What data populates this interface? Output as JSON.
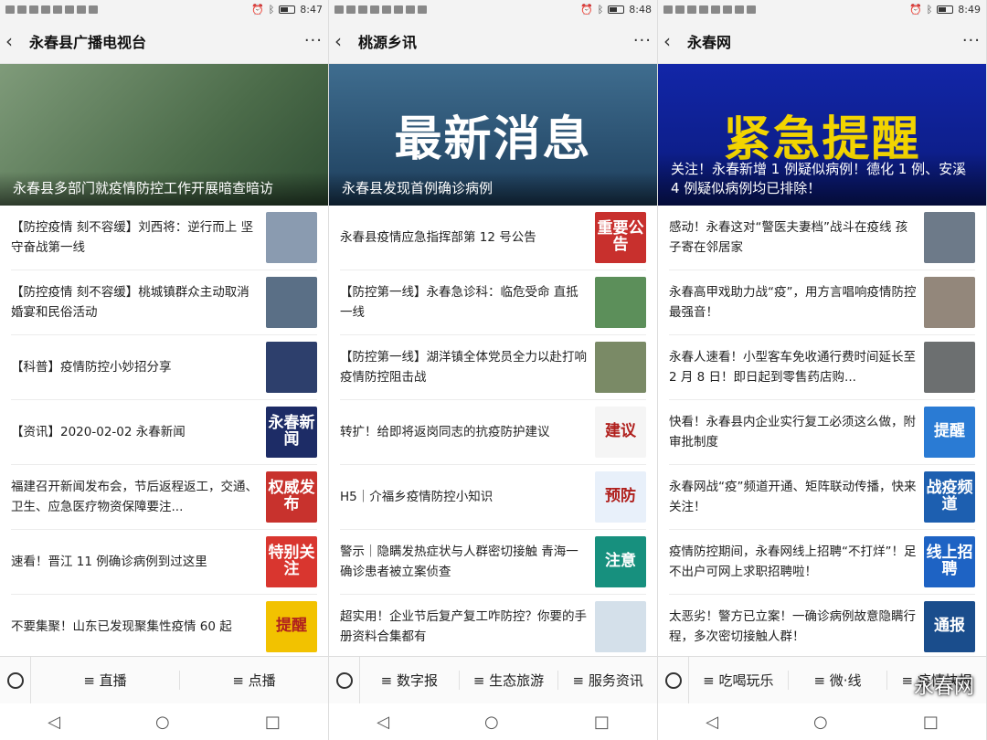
{
  "phones": [
    {
      "status": {
        "time": "8:47"
      },
      "title": "永春县广播电视台",
      "hero": {
        "caption": "永春县多部门就疫情防控工作开展暗查暗访",
        "bigtext": ""
      },
      "items": [
        {
          "text": "【防控疫情 刻不容缓】刘西将：逆行而上 坚守奋战第一线",
          "thumb": ""
        },
        {
          "text": "【防控疫情 刻不容缓】桃城镇群众主动取消婚宴和民俗活动",
          "thumb": ""
        },
        {
          "text": "【科普】疫情防控小妙招分享",
          "thumb": ""
        },
        {
          "text": "【资讯】2020-02-02 永春新闻",
          "thumb": "永春新闻"
        },
        {
          "text": "福建召开新闻发布会，节后返程返工，交通、卫生、应急医疗物资保障要注...",
          "thumb": "权威发布"
        },
        {
          "text": "速看！晋江 11 例确诊病例到过这里",
          "thumb": "特别关注"
        },
        {
          "text": "不要集聚！山东已发现聚集性疫情 60 起",
          "thumb": "提醒"
        }
      ],
      "tabs": [
        "直播",
        "点播"
      ]
    },
    {
      "status": {
        "time": "8:48"
      },
      "title": "桃源乡讯",
      "hero": {
        "caption": "永春县发现首例确诊病例",
        "bigtext": "最新消息"
      },
      "items": [
        {
          "text": "永春县疫情应急指挥部第 12 号公告",
          "thumb": "重要公告"
        },
        {
          "text": "【防控第一线】永春急诊科：临危受命 直抵一线",
          "thumb": ""
        },
        {
          "text": "【防控第一线】湖洋镇全体党员全力以赴打响疫情防控阻击战",
          "thumb": ""
        },
        {
          "text": "转扩！给即将返岗同志的抗疫防护建议",
          "thumb": "建议"
        },
        {
          "text": "H5｜介福乡疫情防控小知识",
          "thumb": "预防"
        },
        {
          "text": "警示｜隐瞒发热症状与人群密切接触 青海一确诊患者被立案侦查",
          "thumb": "注意"
        },
        {
          "text": "超实用！企业节后复产复工咋防控？你要的手册资料合集都有",
          "thumb": ""
        }
      ],
      "tabs": [
        "数字报",
        "生态旅游",
        "服务资讯"
      ]
    },
    {
      "status": {
        "time": "8:49"
      },
      "title": "永春网",
      "hero": {
        "caption": "关注！永春新增 1 例疑似病例！德化 1 例、安溪 4 例疑似病例均已排除！",
        "bigtext": "紧急提醒"
      },
      "items": [
        {
          "text": "感动！永春这对“警医夫妻档”战斗在疫线 孩子寄在邻居家",
          "thumb": ""
        },
        {
          "text": "永春高甲戏助力战“疫”，用方言唱响疫情防控最强音！",
          "thumb": ""
        },
        {
          "text": "永春人速看！小型客车免收通行费时间延长至 2 月 8 日！即日起到零售药店购...",
          "thumb": ""
        },
        {
          "text": "快看！永春县内企业实行复工必须这么做，附审批制度",
          "thumb": "提醒"
        },
        {
          "text": "永春网战“疫”频道开通、矩阵联动传播，快来关注！",
          "thumb": "战疫频道"
        },
        {
          "text": "疫情防控期间，永春网线上招聘“不打烊”！足不出户可网上求职招聘啦！",
          "thumb": "线上招聘"
        },
        {
          "text": "太恶劣！警方已立案！一确诊病例故意隐瞒行程，多次密切接触人群！",
          "thumb": "通报"
        }
      ],
      "tabs": [
        "吃喝玩乐",
        "微·线",
        "疫情快报"
      ]
    }
  ],
  "watermark": "永春网",
  "colors": {
    "thumbs": [
      "#8a9bb0",
      "#5a6f86",
      "#2d3f6c",
      "#1d2c66",
      "#c8322d",
      "#d9362f",
      "#f2c200",
      "#c8302d",
      "#5c8f5a",
      "#7a8a66",
      "#f5f5f5",
      "#e8f0fa",
      "#17907e",
      "#d4e0ea",
      "#6d7a89",
      "#93877b",
      "#6c6f70",
      "#2a7bd4",
      "#1d5fb0",
      "#1e63c4",
      "#1a4d8c"
    ]
  }
}
